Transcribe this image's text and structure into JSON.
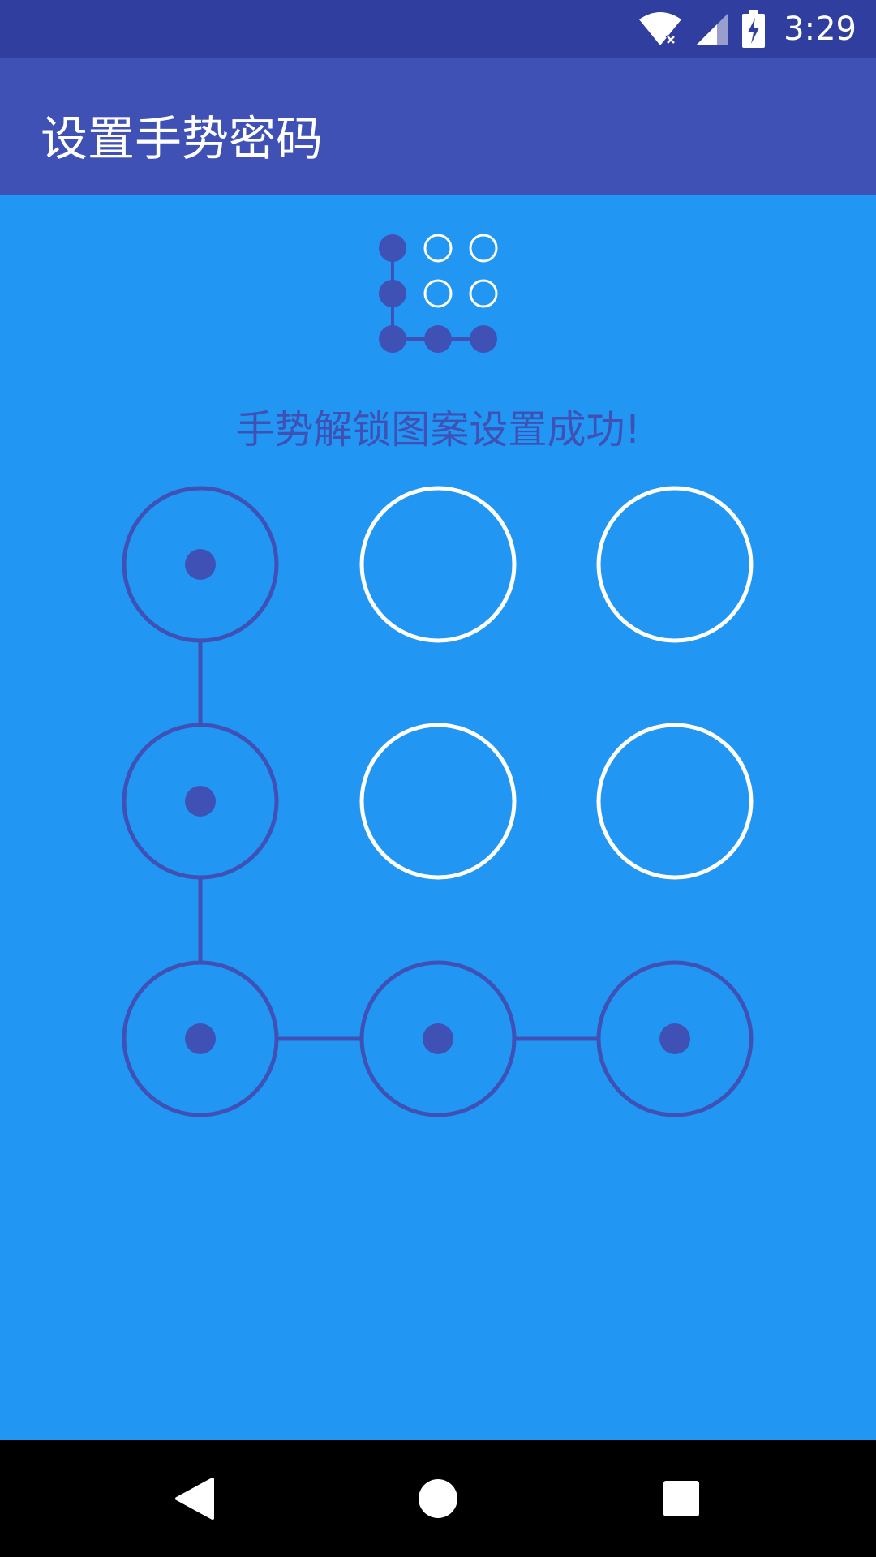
{
  "status_bar": {
    "time": "3:29",
    "icons": [
      "wifi-off-icon",
      "cell-signal-icon",
      "battery-charging-icon"
    ]
  },
  "app_bar": {
    "title": "设置手势密码"
  },
  "preview": {
    "selected": [
      true,
      false,
      false,
      true,
      false,
      false,
      true,
      true,
      true
    ],
    "path": [
      0,
      3,
      6,
      7,
      8
    ]
  },
  "message": "手势解锁图案设置成功!",
  "pattern": {
    "selected": [
      true,
      false,
      false,
      true,
      false,
      false,
      true,
      true,
      true
    ],
    "path": [
      0,
      3,
      6,
      7,
      8
    ]
  },
  "nav_bar": {
    "icons": [
      "back-icon",
      "home-icon",
      "recents-icon"
    ]
  },
  "colors": {
    "status_bar": "#303F9F",
    "app_bar": "#3F51B5",
    "background": "#2196F3",
    "selected": "#3F51B5",
    "unselected": "#FFFFFF",
    "nav_bar": "#000000"
  }
}
